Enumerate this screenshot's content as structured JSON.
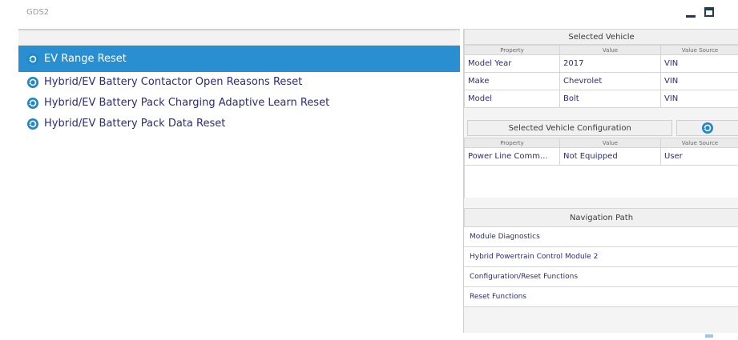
{
  "window": {
    "title": "GDS2"
  },
  "procedures": [
    {
      "label": "EV Range Reset",
      "selected": true
    },
    {
      "label": "Hybrid/EV Battery Contactor Open Reasons Reset",
      "selected": false
    },
    {
      "label": "Hybrid/EV Battery Pack Charging Adaptive Learn Reset",
      "selected": false
    },
    {
      "label": "Hybrid/EV Battery Pack Data Reset",
      "selected": false
    }
  ],
  "selected_vehicle": {
    "title": "Selected Vehicle",
    "columns": [
      "Property",
      "Value",
      "Value Source"
    ],
    "rows": [
      [
        "Model Year",
        "2017",
        "VIN"
      ],
      [
        "Make",
        "Chevrolet",
        "VIN"
      ],
      [
        "Model",
        "Bolt",
        "VIN"
      ]
    ]
  },
  "vehicle_configuration": {
    "title": "Selected Vehicle Configuration",
    "columns": [
      "Property",
      "Value",
      "Value Source"
    ],
    "rows": [
      [
        "Power Line Comm...",
        "Not Equipped",
        "User"
      ]
    ]
  },
  "navigation": {
    "title": "Navigation Path",
    "items": [
      "Module Diagnostics",
      "Hybrid Powertrain Control Module 2",
      "Configuration/Reset Functions",
      "Reset Functions"
    ]
  },
  "colors": {
    "accent": "#2a8fd0",
    "link_text": "#2b2b7a",
    "icon_blue": "#1f86c8"
  }
}
